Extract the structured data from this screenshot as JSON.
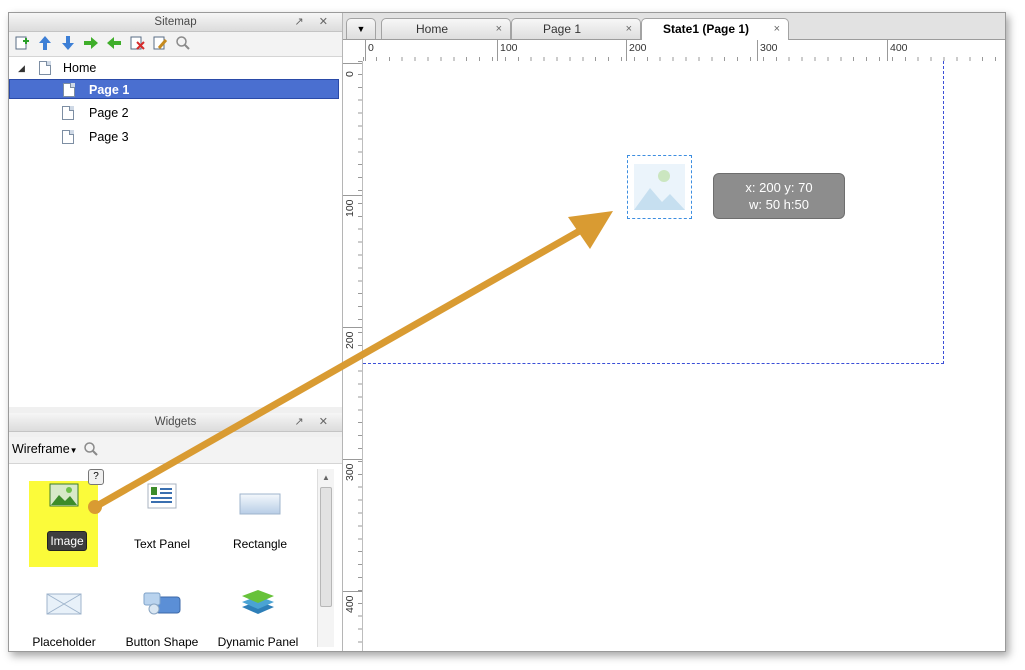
{
  "sitemap": {
    "title": "Sitemap",
    "controls": "↗ ✕",
    "toolbar_icons": [
      "add-page-icon",
      "move-up-icon",
      "move-down-icon",
      "indent-icon",
      "outdent-icon",
      "delete-page-icon",
      "edit-page-icon",
      "search-icon"
    ],
    "tree": [
      {
        "label": "Home",
        "level": 0,
        "expanded": true
      },
      {
        "label": "Page 1",
        "level": 1,
        "selected": true
      },
      {
        "label": "Page 2",
        "level": 1
      },
      {
        "label": "Page 3",
        "level": 1
      }
    ]
  },
  "widgets": {
    "title": "Widgets",
    "controls": "↗ ✕",
    "library": "Wireframe",
    "help": "?",
    "items": [
      {
        "label": "Image",
        "icon": "image-widget-icon",
        "highlighted": true
      },
      {
        "label": "Text Panel",
        "icon": "text-panel-icon"
      },
      {
        "label": "Rectangle",
        "icon": "rectangle-icon"
      },
      {
        "label": "Placeholder",
        "icon": "placeholder-icon"
      },
      {
        "label": "Button Shape",
        "icon": "button-shape-icon"
      },
      {
        "label": "Dynamic Panel",
        "icon": "dynamic-panel-icon"
      }
    ]
  },
  "tabs": [
    {
      "label": "Home",
      "close": "×"
    },
    {
      "label": "Page 1",
      "close": "×"
    },
    {
      "label": "State1 (Page 1)",
      "close": "×",
      "active": true
    }
  ],
  "ruler": {
    "horizontal": [
      "0",
      "100",
      "200",
      "300",
      "400"
    ],
    "vertical": [
      "0",
      "100",
      "200",
      "300",
      "400"
    ]
  },
  "tooltip": {
    "line1": "x: 200  y: 70",
    "line2": "w: 50  h:50"
  },
  "colors": {
    "selection": "#4a6fd0",
    "highlight": "#fbfb3a",
    "arrow": "#d99b32",
    "page_border": "#3b4fd8"
  }
}
